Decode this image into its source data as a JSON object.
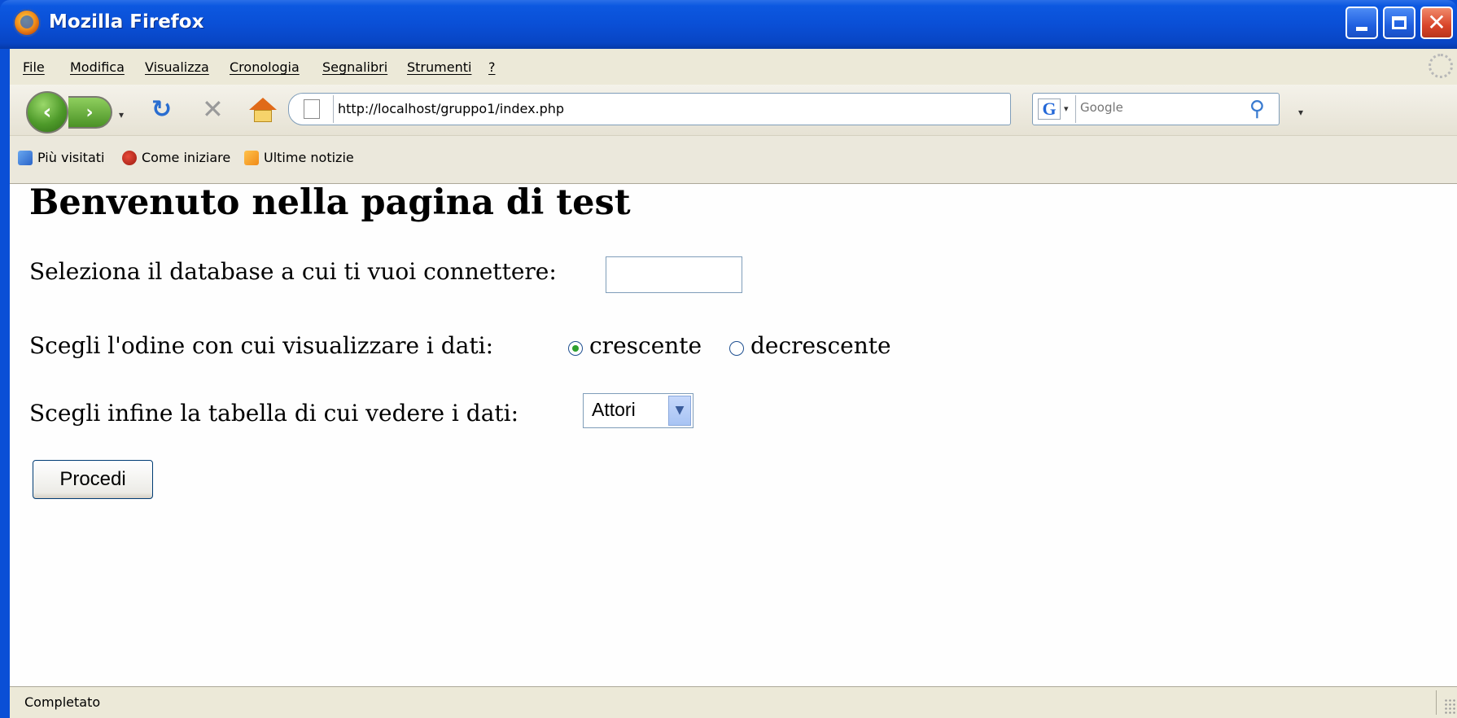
{
  "window": {
    "title": "Mozilla Firefox"
  },
  "menubar": {
    "items": [
      {
        "label": "File"
      },
      {
        "label": "Modifica"
      },
      {
        "label": "Visualizza"
      },
      {
        "label": "Cronologia"
      },
      {
        "label": "Segnalibri"
      },
      {
        "label": "Strumenti"
      },
      {
        "label": "?"
      }
    ]
  },
  "navbar": {
    "back_icon": "back-arrow-icon",
    "forward_icon": "forward-arrow-icon",
    "reload_icon": "reload-icon",
    "stop_icon": "stop-icon",
    "home_icon": "home-icon",
    "url": "http://localhost/gruppo1/index.php",
    "search_placeholder": "Google",
    "search_engine_icon": "google-icon"
  },
  "bookmarks": {
    "items": [
      {
        "label": "Più visitati",
        "icon": "most-visited-icon"
      },
      {
        "label": "Come iniziare",
        "icon": "getting-started-icon"
      },
      {
        "label": "Ultime notizie",
        "icon": "rss-feed-icon"
      }
    ]
  },
  "page": {
    "heading": "Benvenuto nella pagina di test",
    "db_label": "Seleziona il database a cui ti vuoi connettere:",
    "db_value": "",
    "order_label": "Scegli l'odine con cui visualizzare i dati:",
    "order_options": [
      {
        "label": "crescente",
        "checked": true
      },
      {
        "label": "decrescente",
        "checked": false
      }
    ],
    "table_label": "Scegli infine la tabella di cui vedere i dati:",
    "table_selected": "Attori",
    "submit_label": "Procedi"
  },
  "status": {
    "text": "Completato"
  },
  "colors": {
    "titlebar": "#0a4fd6",
    "chrome": "#ece9d8",
    "close_button": "#d9452a",
    "radio_checked": "#2ea02e"
  }
}
